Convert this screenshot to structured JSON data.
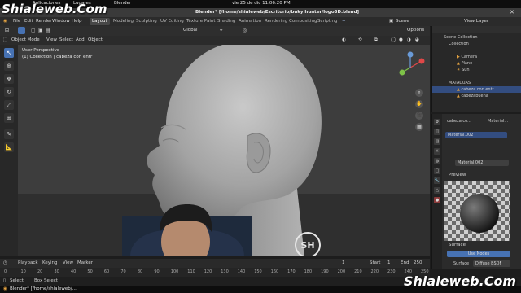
{
  "system_bar": {
    "apps_label": "Aplicaciones",
    "places_label": "Lugares",
    "app_label": "Blender",
    "clock": "vie 25 de dic  11:06:20 PM"
  },
  "window_title": "Blender* [/home/shialeweb/Escritorio/buky hunter/logo3D.blend]",
  "watermark_top": "Shialeweb.Com",
  "watermark_bottom": "Shialeweb.Com",
  "menu": {
    "items": [
      "File",
      "Edit",
      "Render",
      "Window",
      "Help"
    ],
    "workspaces": [
      "Layout",
      "Modeling",
      "Sculpting",
      "UV Editing",
      "Texture Paint",
      "Shading",
      "Animation",
      "Rendering",
      "Compositing",
      "Scripting"
    ],
    "active_workspace": "Layout",
    "scene": "Scene",
    "view_layer": "View Layer"
  },
  "header": {
    "mode": "Object Mode",
    "view": "View",
    "select": "Select",
    "add": "Add",
    "object": "Object",
    "orientation": "Global",
    "options": "Options"
  },
  "viewport": {
    "view_name": "User Perspective",
    "collection_info": "(1) Collection | cabeza con entr"
  },
  "outliner": {
    "title": "Scene Collection",
    "rows": [
      {
        "label": "Scene Collection",
        "selected": false
      },
      {
        "label": "Collection",
        "selected": false
      },
      {
        "label": "Camera",
        "selected": false
      },
      {
        "label": "Plane",
        "selected": false
      },
      {
        "label": "Sun",
        "selected": false
      },
      {
        "label": "MATACUAS",
        "selected": false
      },
      {
        "label": "cabeza con entr",
        "selected": true
      },
      {
        "label": "cabezabuena",
        "selected": false
      }
    ]
  },
  "properties": {
    "object_name": "cabeza co...",
    "material_label": "Material...",
    "material_slot": "Material.002",
    "material_field": "Material.002",
    "preview_title": "Preview",
    "surface_title": "Surface",
    "use_nodes": "Use Nodes",
    "surface_label": "Surface",
    "surface_value": "Diffuse BSDF"
  },
  "timeline": {
    "playback": "Playback",
    "keying": "Keying",
    "view": "View",
    "marker": "Marker",
    "current_frame": "1",
    "start_label": "Start",
    "start": "1",
    "end_label": "End",
    "end": "250"
  },
  "ruler": {
    "ticks": [
      "0",
      "10",
      "20",
      "30",
      "40",
      "50",
      "60",
      "70",
      "80",
      "90",
      "100",
      "110",
      "120",
      "130",
      "140",
      "150",
      "160",
      "170",
      "180",
      "190",
      "200",
      "210",
      "220",
      "230",
      "240",
      "250"
    ]
  },
  "statusbar": {
    "select": "Select",
    "box_select": "Box Select",
    "rotate_view": "Rotate View",
    "object_context": "Object Context Menu",
    "version": "2.91.0"
  },
  "taskbar": {
    "task": "Blender* [/home/shialeweb/...",
    "pager": "1/4"
  },
  "logo_text": "SH",
  "colors": {
    "accent": "#4772b3",
    "selection": "#334d80",
    "viewport_bg": "#3d3d3d",
    "head": "#9c9c9c"
  }
}
